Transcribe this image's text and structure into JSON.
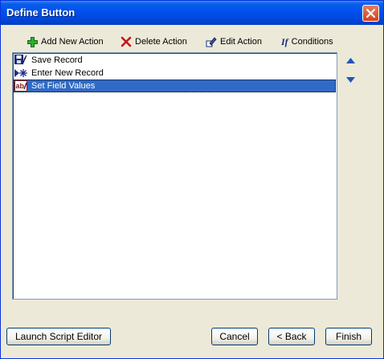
{
  "window": {
    "title": "Define Button"
  },
  "toolbar": {
    "add_label": "Add New Action",
    "delete_label": "Delete Action",
    "edit_label": "Edit Action",
    "conditions_label": "Conditions",
    "conditions_icon_text": "If"
  },
  "actions": {
    "items": [
      {
        "label": "Save Record",
        "icon": "save-record-icon"
      },
      {
        "label": "Enter New Record",
        "icon": "new-record-icon"
      },
      {
        "label": "Set Field Values",
        "icon": "set-field-values-icon",
        "selected": true
      }
    ]
  },
  "footer": {
    "launch_label": "Launch Script Editor",
    "cancel_label": "Cancel",
    "back_label": "< Back",
    "finish_label": "Finish"
  },
  "colors": {
    "selection": "#316ac5",
    "title_bar": "#0050ee",
    "dialog_bg": "#ece9d8"
  }
}
